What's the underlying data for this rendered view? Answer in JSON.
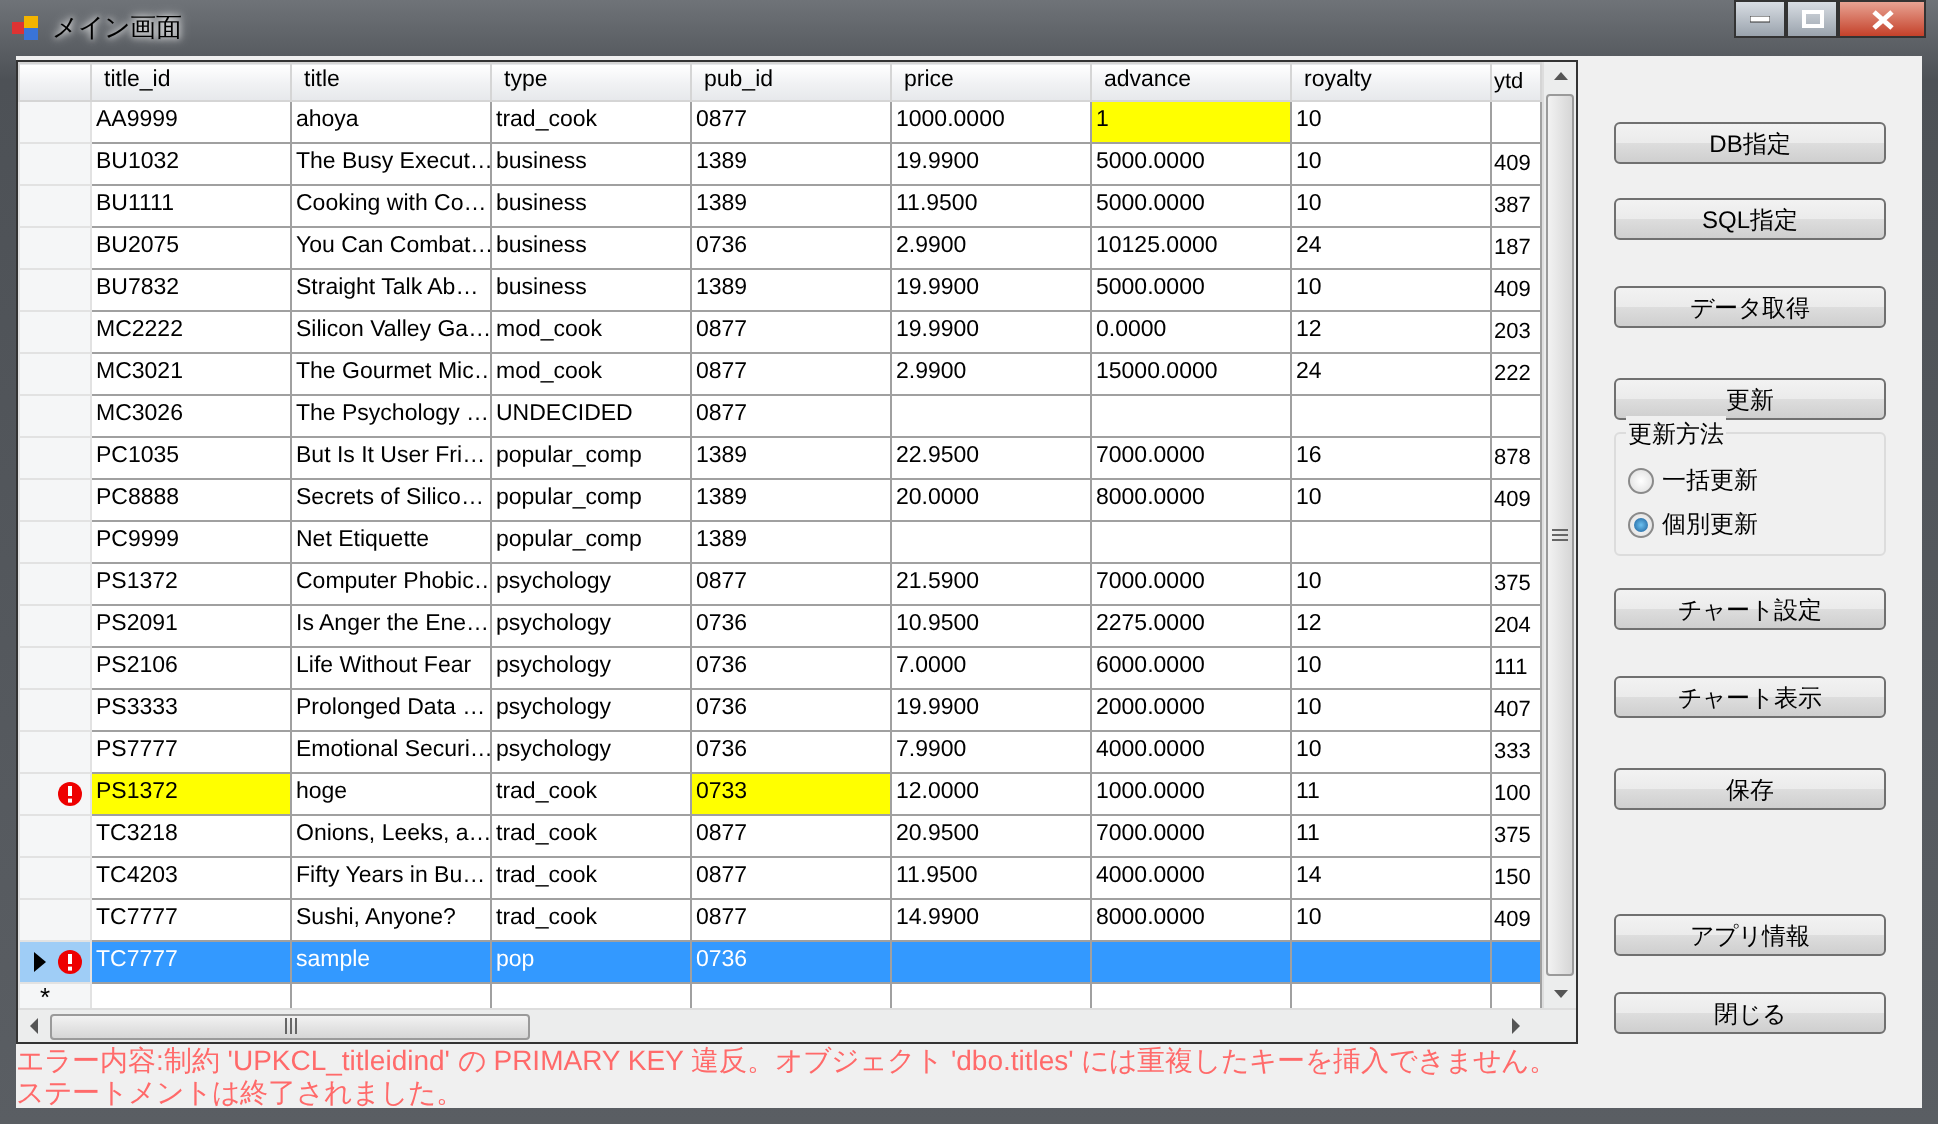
{
  "window": {
    "title": "メイン画面"
  },
  "grid": {
    "columns": [
      "title_id",
      "title",
      "type",
      "pub_id",
      "price",
      "advance",
      "royalty",
      "ytd"
    ],
    "rows": [
      {
        "error": false,
        "current": false,
        "selected": false,
        "cells": [
          {
            "text": "AA9999",
            "highlighted": false
          },
          {
            "text": "ahoya",
            "highlighted": false
          },
          {
            "text": "trad_cook",
            "highlighted": false
          },
          {
            "text": "0877",
            "highlighted": false
          },
          {
            "text": "1000.0000",
            "highlighted": false
          },
          {
            "text": "1",
            "highlighted": true
          },
          {
            "text": "10",
            "highlighted": false
          },
          {
            "highlighted": false
          }
        ]
      },
      {
        "error": false,
        "current": false,
        "selected": false,
        "cells": [
          {
            "text": "BU1032",
            "highlighted": false
          },
          {
            "text": "The Busy Execut…",
            "highlighted": false
          },
          {
            "text": "business",
            "highlighted": false
          },
          {
            "text": "1389",
            "highlighted": false
          },
          {
            "text": "19.9900",
            "highlighted": false
          },
          {
            "text": "5000.0000",
            "highlighted": false
          },
          {
            "text": "10",
            "highlighted": false
          },
          {
            "text": "409",
            "highlighted": false
          }
        ]
      },
      {
        "error": false,
        "current": false,
        "selected": false,
        "cells": [
          {
            "text": "BU1111",
            "highlighted": false
          },
          {
            "text": "Cooking with Co…",
            "highlighted": false
          },
          {
            "text": "business",
            "highlighted": false
          },
          {
            "text": "1389",
            "highlighted": false
          },
          {
            "text": "11.9500",
            "highlighted": false
          },
          {
            "text": "5000.0000",
            "highlighted": false
          },
          {
            "text": "10",
            "highlighted": false
          },
          {
            "text": "387",
            "highlighted": false
          }
        ]
      },
      {
        "error": false,
        "current": false,
        "selected": false,
        "cells": [
          {
            "text": "BU2075",
            "highlighted": false
          },
          {
            "text": "You Can Combat…",
            "highlighted": false
          },
          {
            "text": "business",
            "highlighted": false
          },
          {
            "text": "0736",
            "highlighted": false
          },
          {
            "text": "2.9900",
            "highlighted": false
          },
          {
            "text": "10125.0000",
            "highlighted": false
          },
          {
            "text": "24",
            "highlighted": false
          },
          {
            "text": "187",
            "highlighted": false
          }
        ]
      },
      {
        "error": false,
        "current": false,
        "selected": false,
        "cells": [
          {
            "text": "BU7832",
            "highlighted": false
          },
          {
            "text": "Straight Talk Ab…",
            "highlighted": false
          },
          {
            "text": "business",
            "highlighted": false
          },
          {
            "text": "1389",
            "highlighted": false
          },
          {
            "text": "19.9900",
            "highlighted": false
          },
          {
            "text": "5000.0000",
            "highlighted": false
          },
          {
            "text": "10",
            "highlighted": false
          },
          {
            "text": "409",
            "highlighted": false
          }
        ]
      },
      {
        "error": false,
        "current": false,
        "selected": false,
        "cells": [
          {
            "text": "MC2222",
            "highlighted": false
          },
          {
            "text": "Silicon Valley Ga…",
            "highlighted": false
          },
          {
            "text": "mod_cook",
            "highlighted": false
          },
          {
            "text": "0877",
            "highlighted": false
          },
          {
            "text": "19.9900",
            "highlighted": false
          },
          {
            "text": "0.0000",
            "highlighted": false
          },
          {
            "text": "12",
            "highlighted": false
          },
          {
            "text": "203",
            "highlighted": false
          }
        ]
      },
      {
        "error": false,
        "current": false,
        "selected": false,
        "cells": [
          {
            "text": "MC3021",
            "highlighted": false
          },
          {
            "text": "The Gourmet Mic…",
            "highlighted": false
          },
          {
            "text": "mod_cook",
            "highlighted": false
          },
          {
            "text": "0877",
            "highlighted": false
          },
          {
            "text": "2.9900",
            "highlighted": false
          },
          {
            "text": "15000.0000",
            "highlighted": false
          },
          {
            "text": "24",
            "highlighted": false
          },
          {
            "text": "222",
            "highlighted": false
          }
        ]
      },
      {
        "error": false,
        "current": false,
        "selected": false,
        "cells": [
          {
            "text": "MC3026",
            "highlighted": false
          },
          {
            "text": "The Psychology …",
            "highlighted": false
          },
          {
            "text": "UNDECIDED",
            "highlighted": false
          },
          {
            "text": "0877",
            "highlighted": false
          },
          {
            "highlighted": false
          },
          {
            "highlighted": false
          },
          {
            "highlighted": false
          },
          {
            "highlighted": false
          }
        ]
      },
      {
        "error": false,
        "current": false,
        "selected": false,
        "cells": [
          {
            "text": "PC1035",
            "highlighted": false
          },
          {
            "text": "But Is It User Fri…",
            "highlighted": false
          },
          {
            "text": "popular_comp",
            "highlighted": false
          },
          {
            "text": "1389",
            "highlighted": false
          },
          {
            "text": "22.9500",
            "highlighted": false
          },
          {
            "text": "7000.0000",
            "highlighted": false
          },
          {
            "text": "16",
            "highlighted": false
          },
          {
            "text": "878",
            "highlighted": false
          }
        ]
      },
      {
        "error": false,
        "current": false,
        "selected": false,
        "cells": [
          {
            "text": "PC8888",
            "highlighted": false
          },
          {
            "text": "Secrets of Silico…",
            "highlighted": false
          },
          {
            "text": "popular_comp",
            "highlighted": false
          },
          {
            "text": "1389",
            "highlighted": false
          },
          {
            "text": "20.0000",
            "highlighted": false
          },
          {
            "text": "8000.0000",
            "highlighted": false
          },
          {
            "text": "10",
            "highlighted": false
          },
          {
            "text": "409",
            "highlighted": false
          }
        ]
      },
      {
        "error": false,
        "current": false,
        "selected": false,
        "cells": [
          {
            "text": "PC9999",
            "highlighted": false
          },
          {
            "text": "Net Etiquette",
            "highlighted": false
          },
          {
            "text": "popular_comp",
            "highlighted": false
          },
          {
            "text": "1389",
            "highlighted": false
          },
          {
            "highlighted": false
          },
          {
            "highlighted": false
          },
          {
            "highlighted": false
          },
          {
            "highlighted": false
          }
        ]
      },
      {
        "error": false,
        "current": false,
        "selected": false,
        "cells": [
          {
            "text": "PS1372",
            "highlighted": false
          },
          {
            "text": "Computer Phobic…",
            "highlighted": false
          },
          {
            "text": "psychology",
            "highlighted": false
          },
          {
            "text": "0877",
            "highlighted": false
          },
          {
            "text": "21.5900",
            "highlighted": false
          },
          {
            "text": "7000.0000",
            "highlighted": false
          },
          {
            "text": "10",
            "highlighted": false
          },
          {
            "text": "375",
            "highlighted": false
          }
        ]
      },
      {
        "error": false,
        "current": false,
        "selected": false,
        "cells": [
          {
            "text": "PS2091",
            "highlighted": false
          },
          {
            "text": "Is Anger the Ene…",
            "highlighted": false
          },
          {
            "text": "psychology",
            "highlighted": false
          },
          {
            "text": "0736",
            "highlighted": false
          },
          {
            "text": "10.9500",
            "highlighted": false
          },
          {
            "text": "2275.0000",
            "highlighted": false
          },
          {
            "text": "12",
            "highlighted": false
          },
          {
            "text": "204",
            "highlighted": false
          }
        ]
      },
      {
        "error": false,
        "current": false,
        "selected": false,
        "cells": [
          {
            "text": "PS2106",
            "highlighted": false
          },
          {
            "text": "Life Without Fear",
            "highlighted": false
          },
          {
            "text": "psychology",
            "highlighted": false
          },
          {
            "text": "0736",
            "highlighted": false
          },
          {
            "text": "7.0000",
            "highlighted": false
          },
          {
            "text": "6000.0000",
            "highlighted": false
          },
          {
            "text": "10",
            "highlighted": false
          },
          {
            "text": "111",
            "highlighted": false
          }
        ]
      },
      {
        "error": false,
        "current": false,
        "selected": false,
        "cells": [
          {
            "text": "PS3333",
            "highlighted": false
          },
          {
            "text": "Prolonged Data …",
            "highlighted": false
          },
          {
            "text": "psychology",
            "highlighted": false
          },
          {
            "text": "0736",
            "highlighted": false
          },
          {
            "text": "19.9900",
            "highlighted": false
          },
          {
            "text": "2000.0000",
            "highlighted": false
          },
          {
            "text": "10",
            "highlighted": false
          },
          {
            "text": "407",
            "highlighted": false
          }
        ]
      },
      {
        "error": false,
        "current": false,
        "selected": false,
        "cells": [
          {
            "text": "PS7777",
            "highlighted": false
          },
          {
            "text": "Emotional Securi…",
            "highlighted": false
          },
          {
            "text": "psychology",
            "highlighted": false
          },
          {
            "text": "0736",
            "highlighted": false
          },
          {
            "text": "7.9900",
            "highlighted": false
          },
          {
            "text": "4000.0000",
            "highlighted": false
          },
          {
            "text": "10",
            "highlighted": false
          },
          {
            "text": "333",
            "highlighted": false
          }
        ]
      },
      {
        "error": true,
        "current": false,
        "selected": false,
        "cells": [
          {
            "text": "PS1372",
            "highlighted": true
          },
          {
            "text": "hoge",
            "highlighted": false
          },
          {
            "text": "trad_cook",
            "highlighted": false
          },
          {
            "text": "0733",
            "highlighted": true
          },
          {
            "text": "12.0000",
            "highlighted": false
          },
          {
            "text": "1000.0000",
            "highlighted": false
          },
          {
            "text": "11",
            "highlighted": false
          },
          {
            "text": "100",
            "highlighted": false
          }
        ]
      },
      {
        "error": false,
        "current": false,
        "selected": false,
        "cells": [
          {
            "text": "TC3218",
            "highlighted": false
          },
          {
            "text": "Onions, Leeks, a…",
            "highlighted": false
          },
          {
            "text": "trad_cook",
            "highlighted": false
          },
          {
            "text": "0877",
            "highlighted": false
          },
          {
            "text": "20.9500",
            "highlighted": false
          },
          {
            "text": "7000.0000",
            "highlighted": false
          },
          {
            "text": "11",
            "highlighted": false
          },
          {
            "text": "375",
            "highlighted": false
          }
        ]
      },
      {
        "error": false,
        "current": false,
        "selected": false,
        "cells": [
          {
            "text": "TC4203",
            "highlighted": false
          },
          {
            "text": "Fifty Years in Bu…",
            "highlighted": false
          },
          {
            "text": "trad_cook",
            "highlighted": false
          },
          {
            "text": "0877",
            "highlighted": false
          },
          {
            "text": "11.9500",
            "highlighted": false
          },
          {
            "text": "4000.0000",
            "highlighted": false
          },
          {
            "text": "14",
            "highlighted": false
          },
          {
            "text": "150",
            "highlighted": false
          }
        ]
      },
      {
        "error": false,
        "current": false,
        "selected": false,
        "cells": [
          {
            "text": "TC7777",
            "highlighted": false
          },
          {
            "text": "Sushi, Anyone?",
            "highlighted": false
          },
          {
            "text": "trad_cook",
            "highlighted": false
          },
          {
            "text": "0877",
            "highlighted": false
          },
          {
            "text": "14.9900",
            "highlighted": false
          },
          {
            "text": "8000.0000",
            "highlighted": false
          },
          {
            "text": "10",
            "highlighted": false
          },
          {
            "text": "409",
            "highlighted": false
          }
        ]
      },
      {
        "error": true,
        "current": true,
        "selected": true,
        "cells": [
          {
            "text": "TC7777",
            "highlighted": false
          },
          {
            "text": "sample",
            "highlighted": false
          },
          {
            "text": "pop",
            "highlighted": false
          },
          {
            "text": "0736",
            "highlighted": false
          },
          {
            "highlighted": false
          },
          {
            "highlighted": false
          },
          {
            "highlighted": false
          },
          {
            "highlighted": false
          }
        ]
      }
    ],
    "new_row_marker": "*"
  },
  "error_lines": [
    "エラー内容:制約 'UPKCL_titleidind' の PRIMARY KEY 違反。オブジェクト 'dbo.titles' には重複したキーを挿入できません。",
    "ステートメントは終了されました。"
  ],
  "side_panel": [
    {
      "kind": "button",
      "label": "DB指定"
    },
    {
      "kind": "button",
      "label": "SQL指定"
    },
    {
      "kind": "button",
      "label": "データ取得"
    },
    {
      "kind": "button",
      "label": "更新"
    },
    {
      "kind": "radio_group",
      "label": "更新方法",
      "options": [
        {
          "label": "一括更新",
          "selected": false
        },
        {
          "label": "個別更新",
          "selected": true
        }
      ]
    },
    {
      "kind": "button",
      "label": "チャート設定"
    },
    {
      "kind": "button",
      "label": "チャート表示"
    },
    {
      "kind": "button",
      "label": "保存"
    },
    {
      "kind": "button",
      "label": "アプリ情報"
    },
    {
      "kind": "button",
      "label": "閉じる"
    }
  ]
}
